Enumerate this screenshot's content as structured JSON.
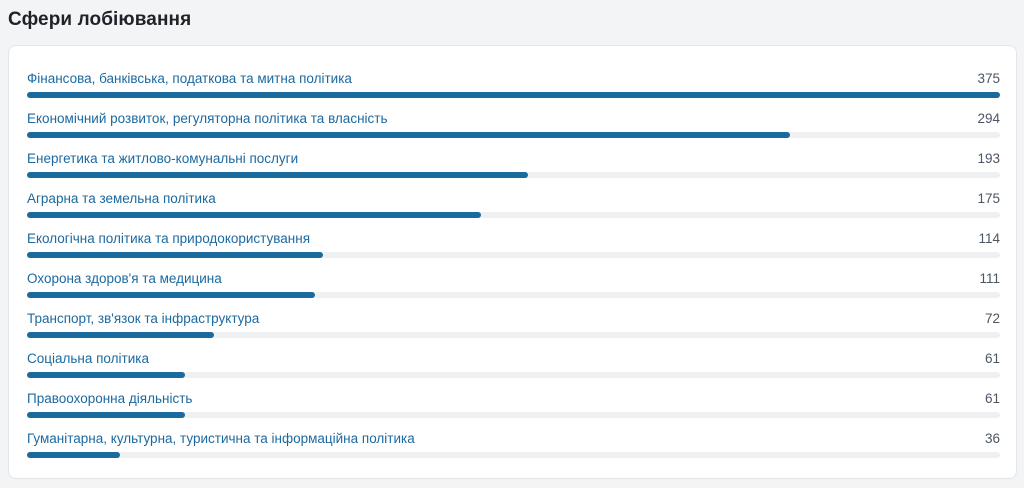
{
  "section": {
    "title": "Сфери лобіювання"
  },
  "colors": {
    "bar_fill": "#1a6a9e",
    "bar_track": "#eef0f2",
    "label_link": "#1c69a0"
  },
  "chart_data": {
    "type": "bar",
    "orientation": "horizontal",
    "title": "Сфери лобіювання",
    "categories": [
      "Фінансова, банківська, податкова та митна політика",
      "Економічний розвиток, регуляторна політика та власність",
      "Енергетика та житлово-комунальні послуги",
      "Аграрна та земельна політика",
      "Екологічна політика та природокористування",
      "Охорона здоров'я та медицина",
      "Транспорт, зв'язок та інфраструктура",
      "Соціальна політика",
      "Правоохоронна діяльність",
      "Гуманітарна, культурна, туристична та інформаційна політика"
    ],
    "values": [
      375,
      294,
      193,
      175,
      114,
      111,
      72,
      61,
      61,
      36
    ],
    "xlim": [
      0,
      375
    ],
    "grid": false,
    "legend": "none"
  }
}
